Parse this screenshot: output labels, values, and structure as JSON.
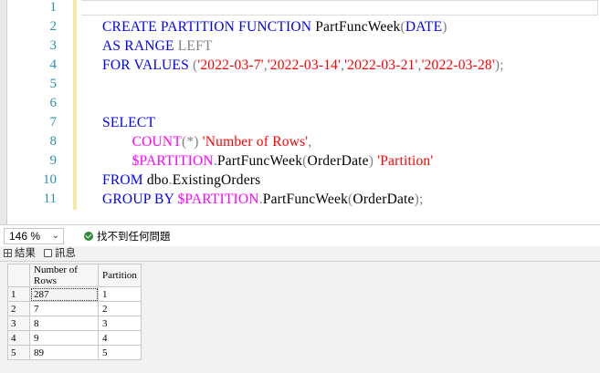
{
  "editor": {
    "lines": [
      {
        "n": "1",
        "segs": []
      },
      {
        "n": "2",
        "segs": [
          {
            "t": "CREATE PARTITION FUNCTION ",
            "c": "kw"
          },
          {
            "t": "PartFuncWeek",
            "c": "pl"
          },
          {
            "t": "(",
            "c": "gr"
          },
          {
            "t": "DATE",
            "c": "kw"
          },
          {
            "t": ")",
            "c": "gr"
          }
        ]
      },
      {
        "n": "3",
        "segs": [
          {
            "t": "AS RANGE ",
            "c": "kw"
          },
          {
            "t": "LEFT",
            "c": "gr"
          }
        ]
      },
      {
        "n": "4",
        "segs": [
          {
            "t": "FOR VALUES ",
            "c": "kw"
          },
          {
            "t": "(",
            "c": "gr"
          },
          {
            "t": "'2022-03-7'",
            "c": "str"
          },
          {
            "t": ",",
            "c": "gr"
          },
          {
            "t": "'2022-03-14'",
            "c": "str"
          },
          {
            "t": ",",
            "c": "gr"
          },
          {
            "t": "'2022-03-21'",
            "c": "str"
          },
          {
            "t": ",",
            "c": "gr"
          },
          {
            "t": "'2022-03-28'",
            "c": "str"
          },
          {
            "t": ");",
            "c": "gr"
          }
        ]
      },
      {
        "n": "5",
        "segs": []
      },
      {
        "n": "6",
        "segs": []
      },
      {
        "n": "7",
        "segs": [
          {
            "t": "SELECT",
            "c": "kw"
          }
        ]
      },
      {
        "n": "8",
        "segs": [
          {
            "t": "        ",
            "c": "pl"
          },
          {
            "t": "COUNT",
            "c": "fn"
          },
          {
            "t": "(*) ",
            "c": "gr"
          },
          {
            "t": "'Number of Rows'",
            "c": "str"
          },
          {
            "t": ",",
            "c": "gr"
          }
        ]
      },
      {
        "n": "9",
        "segs": [
          {
            "t": "        ",
            "c": "pl"
          },
          {
            "t": "$PARTITION",
            "c": "fn"
          },
          {
            "t": ".",
            "c": "gr"
          },
          {
            "t": "PartFuncWeek",
            "c": "pl"
          },
          {
            "t": "(",
            "c": "gr"
          },
          {
            "t": "OrderDate",
            "c": "pl"
          },
          {
            "t": ") ",
            "c": "gr"
          },
          {
            "t": "'Partition'",
            "c": "str"
          }
        ]
      },
      {
        "n": "10",
        "segs": [
          {
            "t": "FROM ",
            "c": "kw"
          },
          {
            "t": "dbo",
            "c": "pl"
          },
          {
            "t": ".",
            "c": "gr"
          },
          {
            "t": "ExistingOrders",
            "c": "pl"
          }
        ]
      },
      {
        "n": "11",
        "segs": [
          {
            "t": "GROUP BY ",
            "c": "kw"
          },
          {
            "t": "$PARTITION",
            "c": "fn"
          },
          {
            "t": ".",
            "c": "gr"
          },
          {
            "t": "PartFuncWeek",
            "c": "pl"
          },
          {
            "t": "(",
            "c": "gr"
          },
          {
            "t": "OrderDate",
            "c": "pl"
          },
          {
            "t": ");",
            "c": "gr"
          }
        ]
      }
    ]
  },
  "statusbar": {
    "zoom": "146 %",
    "status_text": "找不到任何問題"
  },
  "results_tabs": {
    "results_label": "結果",
    "messages_label": "訊息"
  },
  "grid": {
    "columns": [
      "Number of Rows",
      "Partition"
    ],
    "rows": [
      {
        "row": "1",
        "cells": [
          "287",
          "1"
        ]
      },
      {
        "row": "2",
        "cells": [
          "7",
          "2"
        ]
      },
      {
        "row": "3",
        "cells": [
          "8",
          "3"
        ]
      },
      {
        "row": "4",
        "cells": [
          "9",
          "4"
        ]
      },
      {
        "row": "5",
        "cells": [
          "89",
          "5"
        ]
      }
    ]
  },
  "colors": {
    "keyword": "#0000ff",
    "function": "#ff00ff",
    "string": "#ff0000",
    "line_number": "#2b91af",
    "status_ok": "#2e8b3a"
  }
}
